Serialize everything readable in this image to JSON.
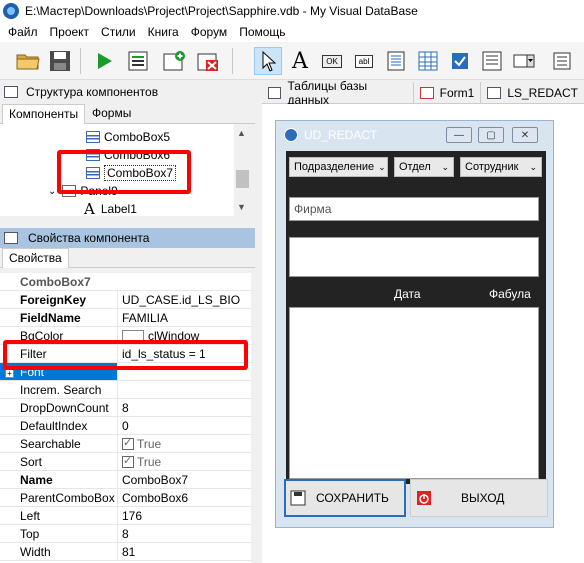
{
  "window": {
    "title": "E:\\Мастер\\Downloads\\Project\\Project\\Sapphire.vdb - My Visual DataBase"
  },
  "menu": [
    "Файл",
    "Проект",
    "Стили",
    "Книга",
    "Форум",
    "Помощь"
  ],
  "toolbar": {
    "icons": [
      "open-folder-icon",
      "save-icon",
      "run-icon",
      "form-list-icon",
      "new-form-icon",
      "delete-form-icon",
      "pointer-icon",
      "label-icon",
      "button-icon",
      "edit-icon",
      "memo-icon",
      "grid-icon",
      "checkbox-icon",
      "list-icon",
      "combo-icon"
    ],
    "label_text": "A",
    "button_text": "OK",
    "edit_text": "abl"
  },
  "left": {
    "structure_title": "Структура компонентов",
    "tabs": [
      "Компоненты",
      "Формы"
    ],
    "tree": [
      {
        "label": "ComboBox5",
        "type": "combo"
      },
      {
        "label": "ComboBox6",
        "type": "combo"
      },
      {
        "label": "ComboBox7",
        "type": "combo",
        "selected": true
      },
      {
        "label": "Panel9",
        "type": "panel"
      },
      {
        "label": "Label1",
        "type": "label"
      }
    ],
    "props_title": "Свойства компонента",
    "props_tab": "Свойства",
    "component_name": "ComboBox7",
    "props": [
      {
        "key": "ForeignKey",
        "value": "UD_CASE.id_LS_BIO",
        "bold": true
      },
      {
        "key": "FieldName",
        "value": "FAMILIA",
        "bold": true
      },
      {
        "key": "BgColor",
        "value": "clWindow"
      },
      {
        "key": "Filter",
        "value": "id_ls_status = 1"
      },
      {
        "key": "Font",
        "value": ""
      },
      {
        "key": "Increm. Search",
        "value": ""
      },
      {
        "key": "DropDownCount",
        "value": "8"
      },
      {
        "key": "DefaultIndex",
        "value": "0"
      },
      {
        "key": "Searchable",
        "value": "True",
        "check": true
      },
      {
        "key": "Sort",
        "value": "True",
        "check": true
      },
      {
        "key": "Name",
        "value": "ComboBox7",
        "bold": true
      },
      {
        "key": "ParentComboBox",
        "value": "ComboBox6"
      },
      {
        "key": "Left",
        "value": "176"
      },
      {
        "key": "Top",
        "value": "8"
      },
      {
        "key": "Width",
        "value": "81"
      }
    ]
  },
  "right": {
    "tabs": [
      "Таблицы базы данных",
      "Form1",
      "LS_REDACT"
    ],
    "form": {
      "title": "UD_REDACT",
      "combos": [
        "Подразделение",
        "Отдел",
        "Сотрудник"
      ],
      "firm_placeholder": "Фирма",
      "col_date": "Дата",
      "col_fabula": "Фабула",
      "save_label": "СОХРАНИТЬ",
      "exit_label": "ВЫХОД"
    }
  },
  "colors": {
    "highlight": "#ff0000",
    "selection": "#0078d7",
    "form_body": "#232323"
  }
}
